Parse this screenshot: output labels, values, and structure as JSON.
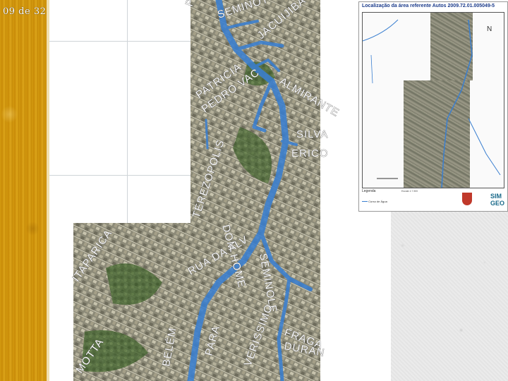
{
  "slide": {
    "counter": "09 de 32"
  },
  "aerial_map": {
    "street_labels": [
      "SEMINOT",
      "JACUIJIBA",
      "PORTUG",
      "PEDRO VAC",
      "ALMIRANTE",
      "PATRICIA",
      "ERICO",
      "SILVA",
      "TEREZOPOLIS",
      "DOM HOME",
      "RUA DA ALV",
      "SEMINOLE",
      "FRAGA",
      "DURAN",
      "ITAPARICA",
      "MOTTA",
      "BELÉM",
      "PARA",
      "VERISSIMO"
    ]
  },
  "location_doc": {
    "title": "Localização da área referente Autos 2009.72.01.005049-5",
    "legend_title": "Legenda",
    "legend_item": "Curso de Água",
    "north_label": "N",
    "footer_text": "Escala 1:7.500",
    "logo_text": "SIM GEO"
  },
  "colors": {
    "river": "#3a7fd0",
    "band": "#d49a10",
    "doc_title": "#1a3a8a"
  }
}
